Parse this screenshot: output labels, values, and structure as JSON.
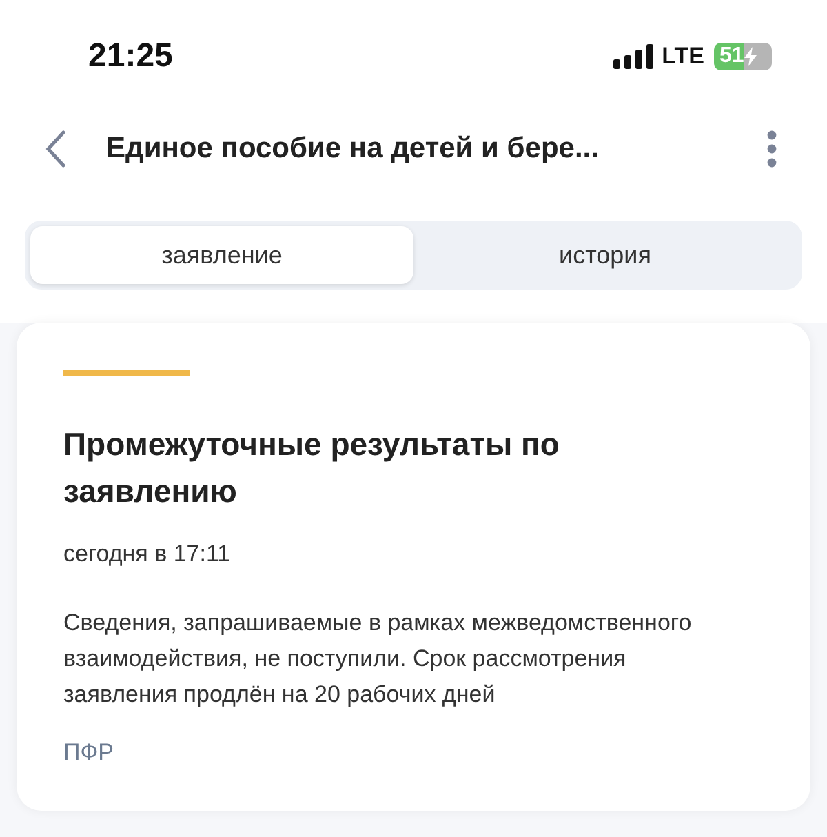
{
  "status_bar": {
    "time": "21:25",
    "network": "LTE",
    "battery": "51"
  },
  "header": {
    "title": "Единое пособие на детей и бере..."
  },
  "tabs": [
    {
      "label": "заявление",
      "selected": true
    },
    {
      "label": "история",
      "selected": false
    }
  ],
  "card": {
    "title": "Промежуточные результаты по заявлению",
    "date": "сегодня в 17:11",
    "text": "Сведения, запрашиваемые в рамках межведомственного взаимодействия, не поступили. Срок рассмотрения заявления продлён на 20 рабочих дней",
    "source": "ПФР"
  }
}
